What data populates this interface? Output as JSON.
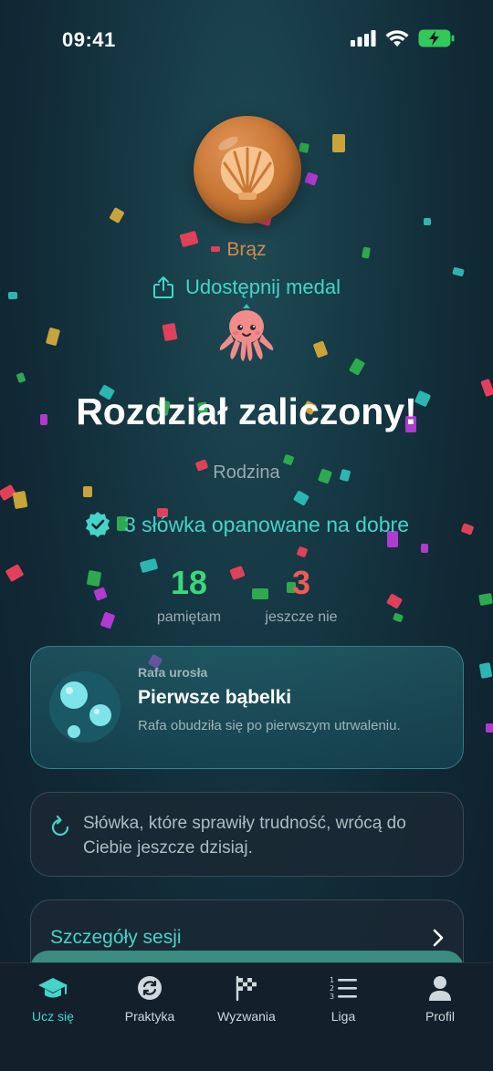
{
  "status_bar": {
    "time": "09:41"
  },
  "medal": {
    "label": "Brąz",
    "icon": "shell-icon"
  },
  "share": {
    "label": "Udostępnij medal"
  },
  "completion": {
    "title": "Rozdział zaliczony!",
    "chapter": "Rodzina"
  },
  "mastered": {
    "text": "3 słówka opanowane na dobre"
  },
  "stats": {
    "remembered": {
      "value": "18",
      "label": "pamiętam"
    },
    "not_yet": {
      "value": "3",
      "label": "jeszcze nie"
    }
  },
  "reef": {
    "kicker": "Rafa urosła",
    "title": "Pierwsze bąbelki",
    "description": "Rafa obudziła się po pierwszym utrwaleniu."
  },
  "info": {
    "text": "Słówka, które sprawiły trudność, wrócą do Ciebie jeszcze dzisiaj."
  },
  "session": {
    "details_label": "Szczegóły sesji"
  },
  "tabs": [
    {
      "label": "Ucz się",
      "icon": "graduation-cap-icon",
      "active": true
    },
    {
      "label": "Praktyka",
      "icon": "refresh-icon"
    },
    {
      "label": "Wyzwania",
      "icon": "checkered-flag-icon"
    },
    {
      "label": "Liga",
      "icon": "ranked-list-icon"
    },
    {
      "label": "Profil",
      "icon": "person-icon"
    }
  ],
  "colors": {
    "accent": "#45d4c8",
    "bronze": "#d98a45",
    "positive": "#3dd67a",
    "negative": "#ef5a55"
  }
}
